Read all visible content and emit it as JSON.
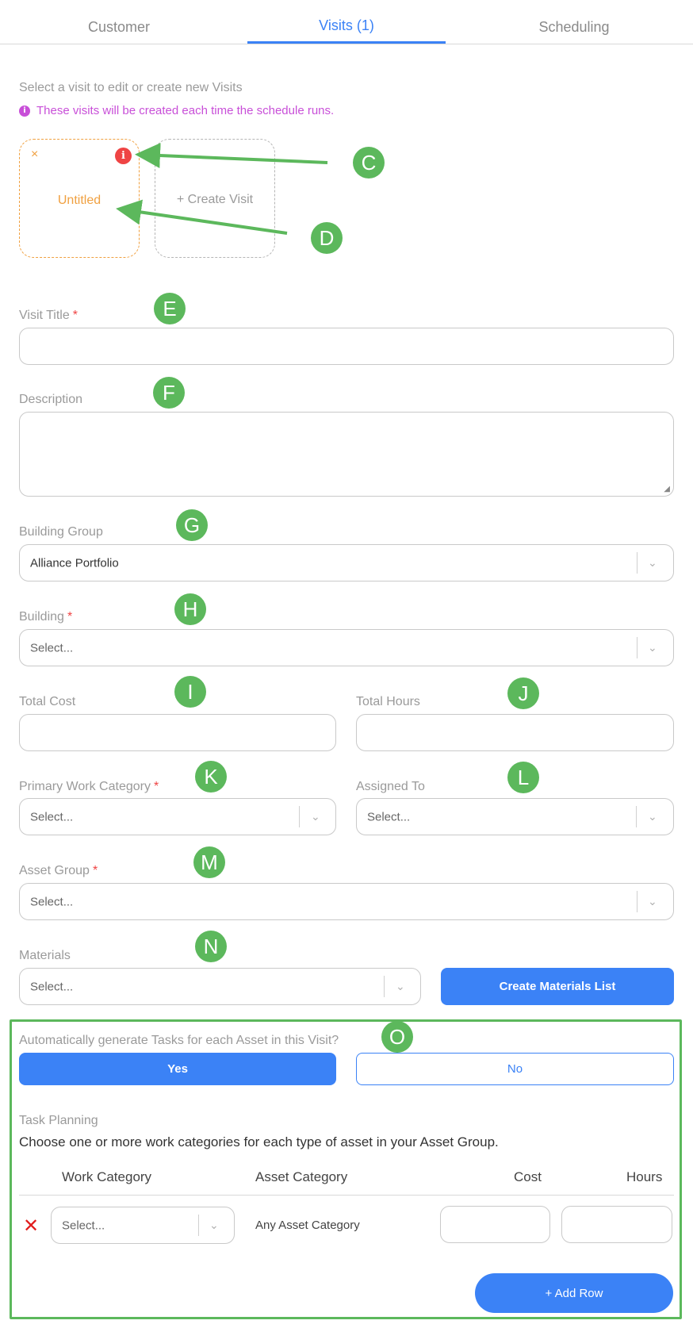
{
  "tabs": [
    {
      "label": "Customer"
    },
    {
      "label": "Visits (1)"
    },
    {
      "label": "Scheduling"
    }
  ],
  "hint": "Select a visit to edit or create new Visits",
  "info_text": "These visits will be created each time the schedule runs.",
  "visits": {
    "card_title": "Untitled",
    "close_glyph": "×",
    "error_glyph": "i",
    "create_label": "+ Create Visit"
  },
  "form": {
    "visit_title_label": "Visit Title",
    "description_label": "Description",
    "building_group_label": "Building Group",
    "building_group_value": "Alliance Portfolio",
    "building_label": "Building",
    "building_placeholder": "Select...",
    "total_cost_label": "Total Cost",
    "total_hours_label": "Total Hours",
    "primary_work_category_label": "Primary Work Category",
    "primary_work_category_placeholder": "Select...",
    "assigned_to_label": "Assigned To",
    "assigned_to_placeholder": "Select...",
    "asset_group_label": "Asset Group",
    "asset_group_placeholder": "Select...",
    "materials_label": "Materials",
    "materials_placeholder": "Select...",
    "create_materials_button": "Create Materials List",
    "required_marker": "*"
  },
  "auto_tasks": {
    "question": "Automatically generate Tasks for each Asset in this Visit?",
    "yes_label": "Yes",
    "no_label": "No",
    "selected": "Yes"
  },
  "task_planning": {
    "title": "Task Planning",
    "description": "Choose one or more work categories for each type of asset in your Asset Group.",
    "columns": [
      "Work Category",
      "Asset Category",
      "Cost",
      "Hours"
    ],
    "rows": [
      {
        "work_category_placeholder": "Select...",
        "asset_category": "Any Asset Category",
        "cost": "",
        "hours": ""
      }
    ],
    "remove_glyph": "✕",
    "add_row_label": "+ Add Row"
  },
  "annotations": {
    "markers": [
      "C",
      "D",
      "E",
      "F",
      "G",
      "H",
      "I",
      "J",
      "K",
      "L",
      "M",
      "N",
      "O"
    ],
    "color": "#5cb85c"
  },
  "colors": {
    "accent": "#3b82f6",
    "warning": "#f0a040",
    "error": "#ef4444",
    "info": "#c84fd8"
  },
  "icons": {
    "chevron": "⌄"
  }
}
